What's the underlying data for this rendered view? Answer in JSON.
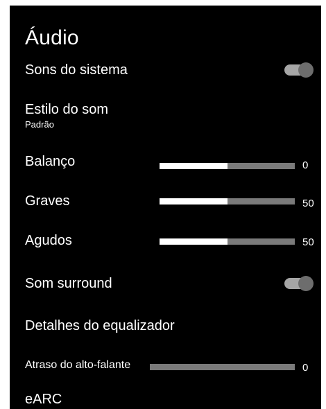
{
  "title": "Áudio",
  "items": {
    "sons_do_sistema": {
      "label": "Sons do sistema",
      "toggle_on": true
    },
    "estilo_do_som": {
      "label": "Estilo do som",
      "value": "Padrão"
    },
    "balanco": {
      "label": "Balanço",
      "value": "0",
      "level_fraction": 0.5
    },
    "graves": {
      "label": "Graves",
      "value": "50",
      "level_fraction": 0.5
    },
    "agudos": {
      "label": "Agudos",
      "value": "50",
      "level_fraction": 0.5
    },
    "som_surround": {
      "label": "Som surround",
      "toggle_on": true
    },
    "detalhes_equalizador": {
      "label": "Detalhes do equalizador"
    },
    "atraso_alto_falante": {
      "label": "Atraso do alto-falante",
      "value": "0",
      "level_fraction": 0.0
    },
    "earc": {
      "label": "eARC"
    }
  },
  "colors": {
    "panel_bg": "#000000",
    "text": "#ffffff",
    "slider_fill": "#ffffff",
    "slider_track": "#7a7a7a",
    "toggle_track": "#a6a6a6",
    "toggle_knob": "#6d6d6d"
  }
}
